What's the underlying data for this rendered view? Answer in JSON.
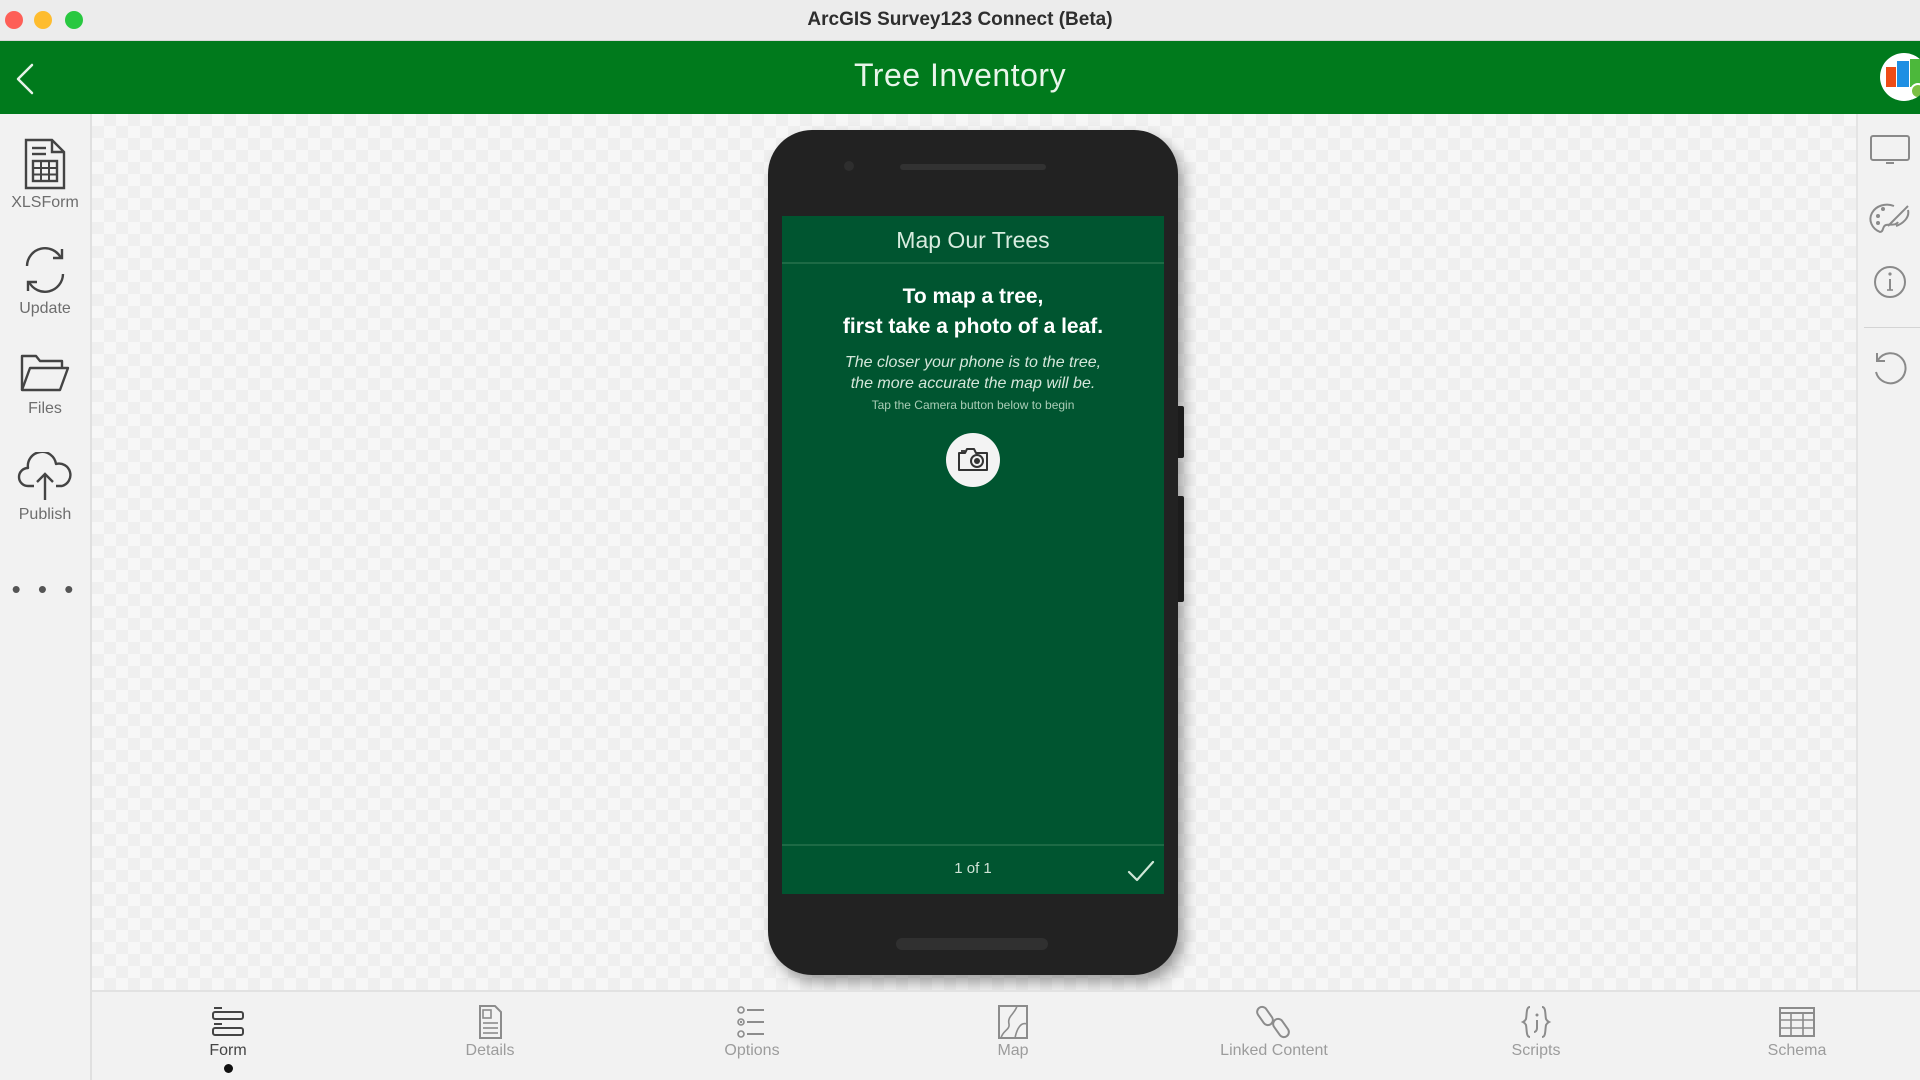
{
  "window": {
    "title": "ArcGIS Survey123 Connect (Beta)",
    "controls": [
      "close",
      "minimize",
      "maximize"
    ]
  },
  "header": {
    "title": "Tree Inventory",
    "back_icon": "chevron-left-icon",
    "avatar_icon": "survey-thumbnail-icon",
    "background_color": "#007a1c"
  },
  "left_toolbar": {
    "items": [
      {
        "label": "XLSForm",
        "icon": "spreadsheet-icon"
      },
      {
        "label": "Update",
        "icon": "refresh-icon"
      },
      {
        "label": "Files",
        "icon": "folder-icon"
      },
      {
        "label": "Publish",
        "icon": "cloud-upload-icon"
      }
    ],
    "more_label": "• • •"
  },
  "right_toolbar": {
    "items": [
      {
        "icon": "monitor-icon"
      },
      {
        "icon": "palette-icon"
      },
      {
        "icon": "info-icon"
      },
      {
        "icon": "reset-icon"
      }
    ]
  },
  "phone_preview": {
    "form_title": "Map Our Trees",
    "heading_line1": "To map a tree,",
    "heading_line2": "first take a photo of a leaf.",
    "italic_line1": "The closer your phone is to the tree,",
    "italic_line2": "the more accurate the map will be.",
    "hint": "Tap the Camera button below to begin",
    "camera_icon": "camera-icon",
    "page_indicator": "1 of 1",
    "submit_icon": "checkmark-icon",
    "screen_color": "#005530"
  },
  "bottom_tabs": {
    "active": "Form",
    "items": [
      {
        "label": "Form",
        "icon": "form-icon"
      },
      {
        "label": "Details",
        "icon": "details-icon"
      },
      {
        "label": "Options",
        "icon": "options-list-icon"
      },
      {
        "label": "Map",
        "icon": "map-icon"
      },
      {
        "label": "Linked Content",
        "icon": "link-icon"
      },
      {
        "label": "Scripts",
        "icon": "scripts-icon"
      },
      {
        "label": "Schema",
        "icon": "table-icon"
      }
    ]
  }
}
